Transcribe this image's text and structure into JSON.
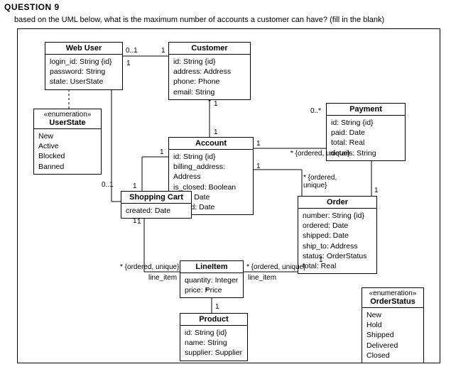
{
  "question": {
    "number": "QUESTION 9",
    "prompt": "based on the UML below, what is the maximum number of accounts a customer can have? (fill in the blank)"
  },
  "classes": {
    "webuser": {
      "title": "Web User",
      "attrs": [
        "login_id: String {id}",
        "password: String",
        "state: UserState"
      ]
    },
    "customer": {
      "title": "Customer",
      "attrs": [
        "id: String {id}",
        "address: Address",
        "phone: Phone",
        "email: String"
      ]
    },
    "userstate": {
      "stereo": "«enumeration»",
      "title": "UserState",
      "vals": [
        "New",
        "Active",
        "Blocked",
        "Banned"
      ]
    },
    "account": {
      "title": "Account",
      "attrs": [
        "id: String {id}",
        "billing_address: Address",
        "is_closed: Boolean",
        "open: Date",
        "closed: Date"
      ]
    },
    "payment": {
      "title": "Payment",
      "attrs": [
        "id: String {id}",
        "paid: Date",
        "total: Real",
        "details: String"
      ]
    },
    "cart": {
      "title": "Shopping Cart",
      "attrs": [
        "created: Date"
      ]
    },
    "order": {
      "title": "Order",
      "attrs": [
        "number: String {id}",
        "ordered: Date",
        "shipped: Date",
        "ship_to: Address",
        "status: OrderStatus",
        "total: Real"
      ]
    },
    "lineitem": {
      "title": "LineItem",
      "attrs": [
        "quantity: Integer",
        "price: Price"
      ]
    },
    "product": {
      "title": "Product",
      "attrs": [
        "id: String {id}",
        "name: String",
        "supplier: Supplier"
      ]
    },
    "orderstatus": {
      "stereo": "«enumeration»",
      "title": "OrderStatus",
      "vals": [
        "New",
        "Hold",
        "Shipped",
        "Delivered",
        "Closed"
      ]
    }
  },
  "m": {
    "wu_cu_l": "0..1",
    "wu_cu_r": "1",
    "cu_ac_t": "1",
    "cu_ac_b": "1",
    "ac_ca_l": "1",
    "ac_ca_r": "1",
    "wu_ca_t": "0..1",
    "wu_ca_b": "1",
    "ac_pm_l": "1",
    "ac_pm_r": "0..*",
    "ac_pm_c": "* {ordered, unique}",
    "ac_or_l": "1",
    "ac_or_c": "* {ordered,\nunique}",
    "or_pm": "1",
    "or_li_r": "1",
    "or_li_c": "* {ordered, unique}",
    "or_li_role": "line_item",
    "ca_li_l": "1",
    "ca_li_c": "* {ordered, unique}",
    "ca_li_role": "line_item",
    "li_pr": "1",
    "pr_li": "*"
  }
}
